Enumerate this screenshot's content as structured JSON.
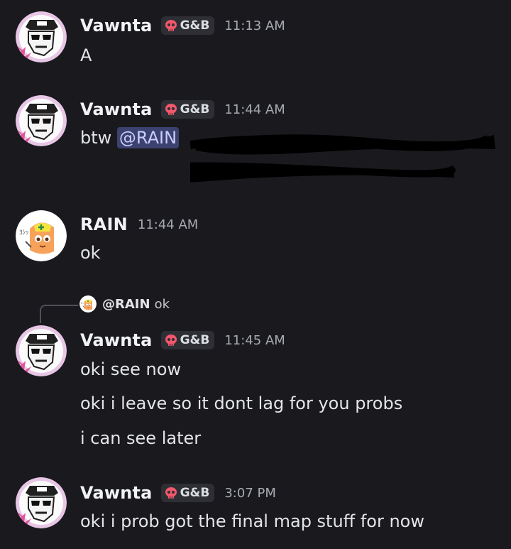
{
  "messages": [
    {
      "author": "Vawnta",
      "tag": "G&B",
      "time": "11:13 AM",
      "lines": [
        "A"
      ]
    },
    {
      "author": "Vawnta",
      "tag": "G&B",
      "time": "11:44 AM",
      "prefix": "btw ",
      "mention": "@RAIN"
    },
    {
      "author": "RAIN",
      "time": "11:44 AM",
      "lines": [
        "ok"
      ]
    },
    {
      "author": "Vawnta",
      "tag": "G&B",
      "time": "11:45 AM",
      "reply": {
        "name": "@RAIN",
        "text": "ok"
      },
      "lines": [
        "oki see now",
        "oki i leave so it dont lag for you probs",
        "i can see later"
      ]
    },
    {
      "author": "Vawnta",
      "tag": "G&B",
      "time": "3:07 PM",
      "lines": [
        "oki i prob got the final map stuff for now"
      ]
    }
  ],
  "colors": {
    "background": "#1a1a1e",
    "mention_bg": "#3c4270",
    "tag_bg": "#2e2f35",
    "skull": "#f2576b"
  },
  "icons": {
    "tag": "skull-icon",
    "vawnta_avatar": "pixel-avatar-icon",
    "rain_avatar": "anime-avatar-icon"
  }
}
